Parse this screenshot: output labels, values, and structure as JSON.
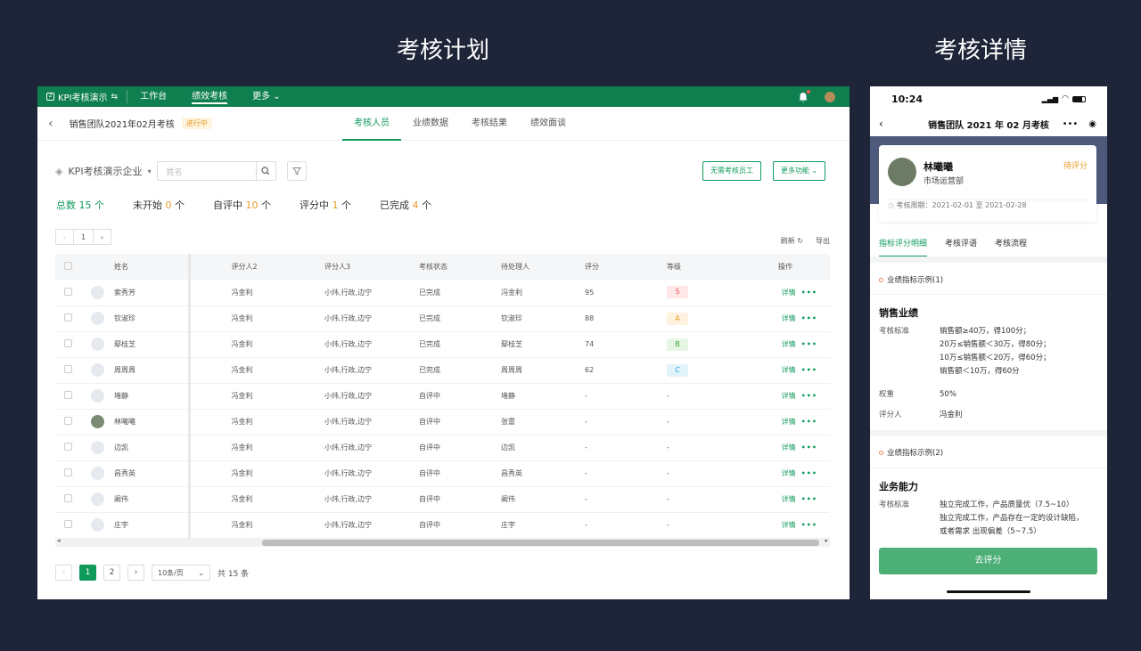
{
  "headings": {
    "plan": "考核计划",
    "detail": "考核详情"
  },
  "topbar": {
    "app_name": "KPI考核演示",
    "logo_glyph": "⇆",
    "nav": [
      "工作台",
      "绩效考核",
      "更多"
    ],
    "active_nav": "绩效考核"
  },
  "subbar": {
    "title": "销售团队2021年02月考核",
    "status": "进行中",
    "tabs": [
      "考核人员",
      "业绩数据",
      "考核结果",
      "绩效面谈"
    ]
  },
  "filter": {
    "company": "KPI考核演示企业",
    "search_placeholder": "姓名",
    "btn_exempt": "无需考核员工",
    "btn_more": "更多功能"
  },
  "stats": [
    {
      "label": "总数",
      "value": "15",
      "unit": "个"
    },
    {
      "label": "未开始",
      "value": "0",
      "unit": "个"
    },
    {
      "label": "自评中",
      "value": "10",
      "unit": "个"
    },
    {
      "label": "评分中",
      "value": "1",
      "unit": "个"
    },
    {
      "label": "已完成",
      "value": "4",
      "unit": "个"
    }
  ],
  "pager_top": {
    "current": "1"
  },
  "tools": {
    "refresh": "刷新",
    "export": "导出"
  },
  "table": {
    "headers": [
      "姓名",
      "评分人2",
      "评分人3",
      "考核状态",
      "待处理人",
      "评分",
      "等级",
      "操作"
    ],
    "rows": [
      {
        "name": "索秀芳",
        "r2": "冯金利",
        "r3": "小炜,行政,边宁",
        "status": "已完成",
        "pending": "冯金利",
        "score": "95",
        "grade": "S",
        "op": "详情"
      },
      {
        "name": "钦淑珍",
        "r2": "冯金利",
        "r3": "小炜,行政,边宁",
        "status": "已完成",
        "pending": "钦淑珍",
        "score": "88",
        "grade": "A",
        "op": "详情"
      },
      {
        "name": "鄢桂芝",
        "r2": "冯金利",
        "r3": "小炜,行政,边宁",
        "status": "已完成",
        "pending": "鄢桂芝",
        "score": "74",
        "grade": "B",
        "op": "详情"
      },
      {
        "name": "周周周",
        "r2": "冯金利",
        "r3": "小炜,行政,边宁",
        "status": "已完成",
        "pending": "周周周",
        "score": "62",
        "grade": "C",
        "op": "详情"
      },
      {
        "name": "堵静",
        "r2": "冯金利",
        "r3": "小炜,行政,边宁",
        "status": "自评中",
        "pending": "堵静",
        "score": "-",
        "grade": "-",
        "op": "详情"
      },
      {
        "name": "林曦曦",
        "r2": "冯金利",
        "r3": "小炜,行政,边宁",
        "status": "自评中",
        "pending": "张雷",
        "score": "-",
        "grade": "-",
        "op": "详情",
        "photo": true
      },
      {
        "name": "边凯",
        "r2": "冯金利",
        "r3": "小炜,行政,边宁",
        "status": "自评中",
        "pending": "边凯",
        "score": "-",
        "grade": "-",
        "op": "详情"
      },
      {
        "name": "昌秀英",
        "r2": "冯金利",
        "r3": "小炜,行政,边宁",
        "status": "自评中",
        "pending": "昌秀英",
        "score": "-",
        "grade": "-",
        "op": "详情"
      },
      {
        "name": "阚伟",
        "r2": "冯金利",
        "r3": "小炜,行政,边宁",
        "status": "自评中",
        "pending": "阚伟",
        "score": "-",
        "grade": "-",
        "op": "详情"
      },
      {
        "name": "庄宇",
        "r2": "冯金利",
        "r3": "小炜,行政,边宁",
        "status": "自评中",
        "pending": "庄宇",
        "score": "-",
        "grade": "-",
        "op": "详情"
      }
    ]
  },
  "pager": {
    "pages": [
      "1",
      "2"
    ],
    "current": "1",
    "page_size": "10条/页",
    "total": "共 15 条"
  },
  "mobile": {
    "time": "10:24",
    "title": "销售团队 2021 年 02 月考核",
    "person": {
      "name": "林曦曦",
      "dept": "市场运营部",
      "status": "待评分",
      "period": "考核周期：2021-02-01 至 2021-02-28"
    },
    "tabs": [
      "指标评分明细",
      "考核评语",
      "考核流程"
    ],
    "sec1": "业绩指标示例(1)",
    "block1": {
      "title": "销售业绩",
      "k_standard": "考核标准",
      "standard": [
        "销售额≥40万，得100分；",
        "20万≤销售额＜30万，得80分；",
        "10万≤销售额＜20万，得60分；",
        "销售额＜10万，得60分"
      ],
      "k_weight": "权重",
      "weight": "50%",
      "k_rater": "评分人",
      "rater": "冯金利"
    },
    "sec2": "业绩指标示例(2)",
    "block2": {
      "title": "业务能力",
      "k_standard": "考核标准",
      "standard": [
        "独立完成工作，产品质量优（7.5~10）",
        "独立完成工作，产品存在一定的设计缺陷，",
        "或者需求 出现偏差（5~7.5）"
      ]
    },
    "button": "去评分"
  },
  "colors": {
    "brand": "#0f7f4f",
    "accent": "#0f9a5c",
    "warning": "#e79b26",
    "bg": "#1f2538"
  }
}
